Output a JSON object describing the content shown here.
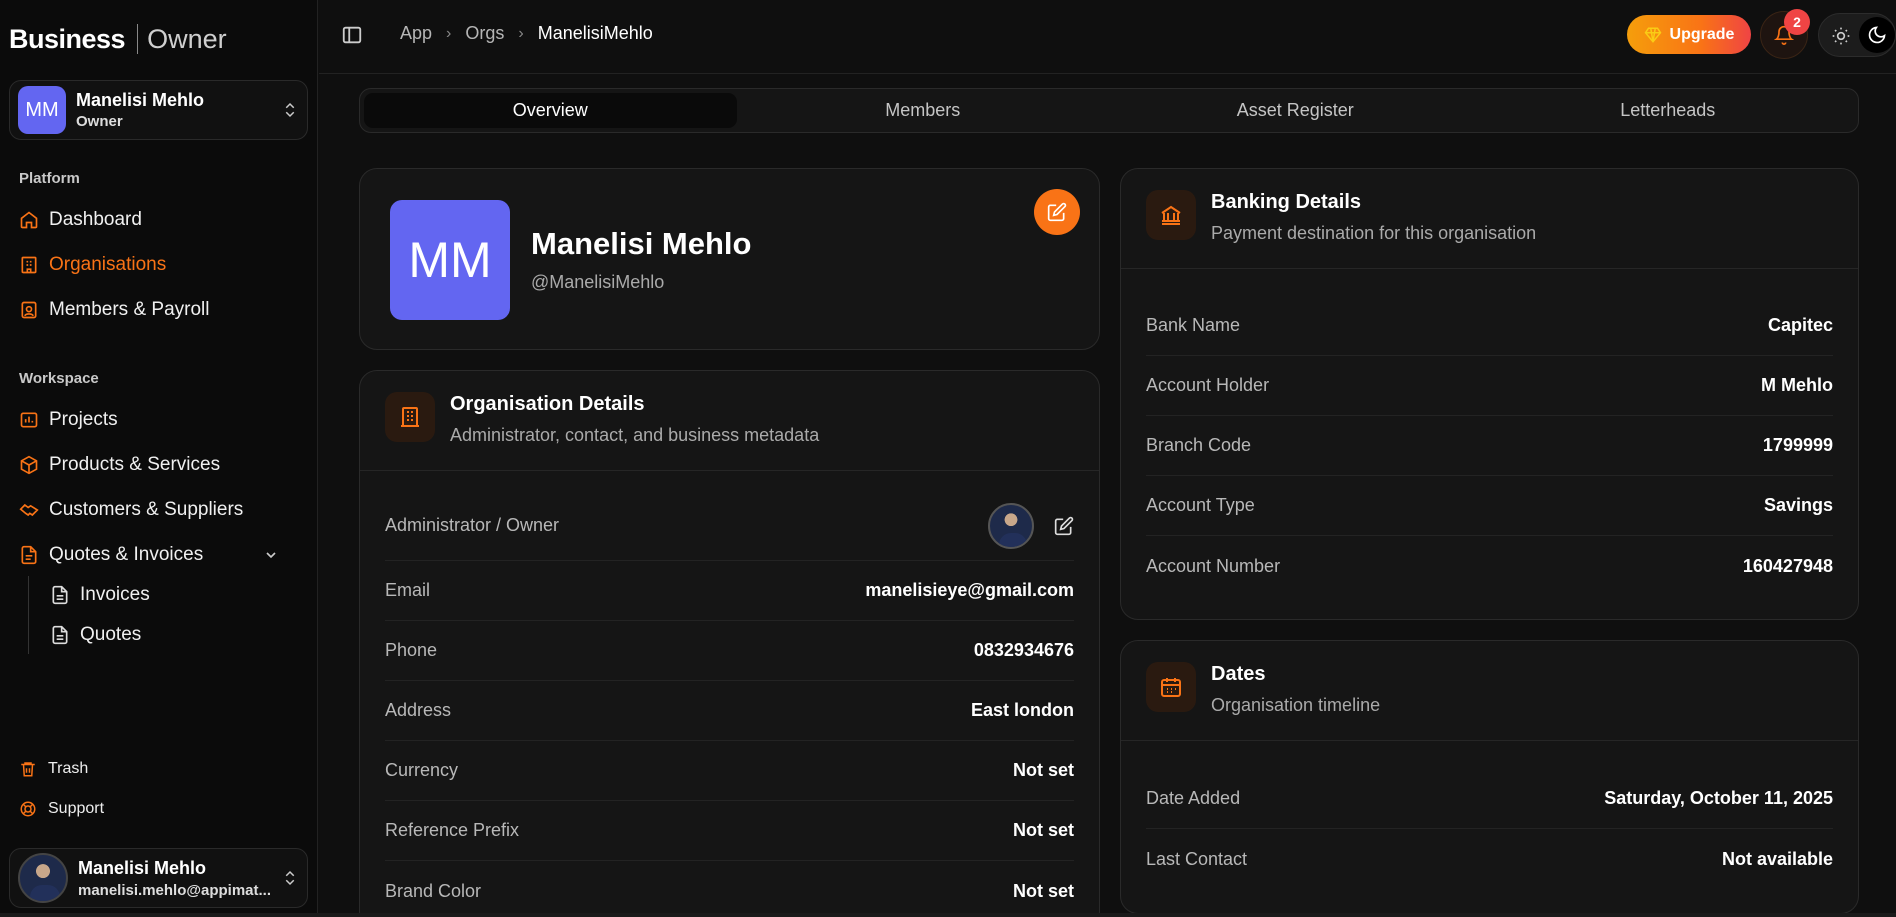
{
  "brand": {
    "primary": "Business",
    "secondary": "Owner"
  },
  "org_switcher": {
    "initials": "MM",
    "name": "Manelisi Mehlo",
    "role": "Owner"
  },
  "sidebar": {
    "platform_label": "Platform",
    "platform_items": [
      {
        "label": "Dashboard",
        "icon": "home-icon"
      },
      {
        "label": "Organisations",
        "icon": "building-icon",
        "active": true
      },
      {
        "label": "Members & Payroll",
        "icon": "id-badge-icon"
      }
    ],
    "workspace_label": "Workspace",
    "workspace_items": [
      {
        "label": "Projects",
        "icon": "chart-icon"
      },
      {
        "label": "Products & Services",
        "icon": "package-icon"
      },
      {
        "label": "Customers & Suppliers",
        "icon": "handshake-icon"
      },
      {
        "label": "Quotes & Invoices",
        "icon": "document-icon"
      }
    ],
    "sub_items": [
      {
        "label": "Invoices",
        "icon": "file-icon"
      },
      {
        "label": "Quotes",
        "icon": "file-icon"
      }
    ],
    "footer_items": [
      {
        "label": "Trash",
        "icon": "trash-icon"
      },
      {
        "label": "Support",
        "icon": "lifebuoy-icon"
      }
    ]
  },
  "user": {
    "name": "Manelisi Mehlo",
    "email": "manelisi.mehlo@appimat..."
  },
  "breadcrumb": {
    "items": [
      "App",
      "Orgs"
    ],
    "current": "ManelisiMehlo"
  },
  "topbar": {
    "upgrade_label": "Upgrade",
    "notification_count": "2"
  },
  "tabs": [
    "Overview",
    "Members",
    "Asset Register",
    "Letterheads"
  ],
  "profile": {
    "initials": "MM",
    "name": "Manelisi Mehlo",
    "handle": "@ManelisiMehlo"
  },
  "org_details": {
    "title": "Organisation Details",
    "subtitle": "Administrator, contact, and business metadata",
    "owner_label": "Administrator / Owner",
    "rows": [
      {
        "label": "Email",
        "value": "manelisieye@gmail.com"
      },
      {
        "label": "Phone",
        "value": "0832934676"
      },
      {
        "label": "Address",
        "value": "East london"
      },
      {
        "label": "Currency",
        "value": "Not set"
      },
      {
        "label": "Reference Prefix",
        "value": "Not set"
      },
      {
        "label": "Brand Color",
        "value": "Not set"
      }
    ]
  },
  "banking": {
    "title": "Banking Details",
    "subtitle": "Payment destination for this organisation",
    "rows": [
      {
        "label": "Bank Name",
        "value": "Capitec"
      },
      {
        "label": "Account Holder",
        "value": "M Mehlo"
      },
      {
        "label": "Branch Code",
        "value": "1799999"
      },
      {
        "label": "Account Type",
        "value": "Savings"
      },
      {
        "label": "Account Number",
        "value": "160427948"
      }
    ]
  },
  "dates": {
    "title": "Dates",
    "subtitle": "Organisation timeline",
    "rows": [
      {
        "label": "Date Added",
        "value": "Saturday, October 11, 2025"
      },
      {
        "label": "Last Contact",
        "value": "Not available"
      }
    ]
  },
  "colors": {
    "accent": "#f97316",
    "avatar_bg": "#6366f1",
    "badge": "#ef4444"
  }
}
